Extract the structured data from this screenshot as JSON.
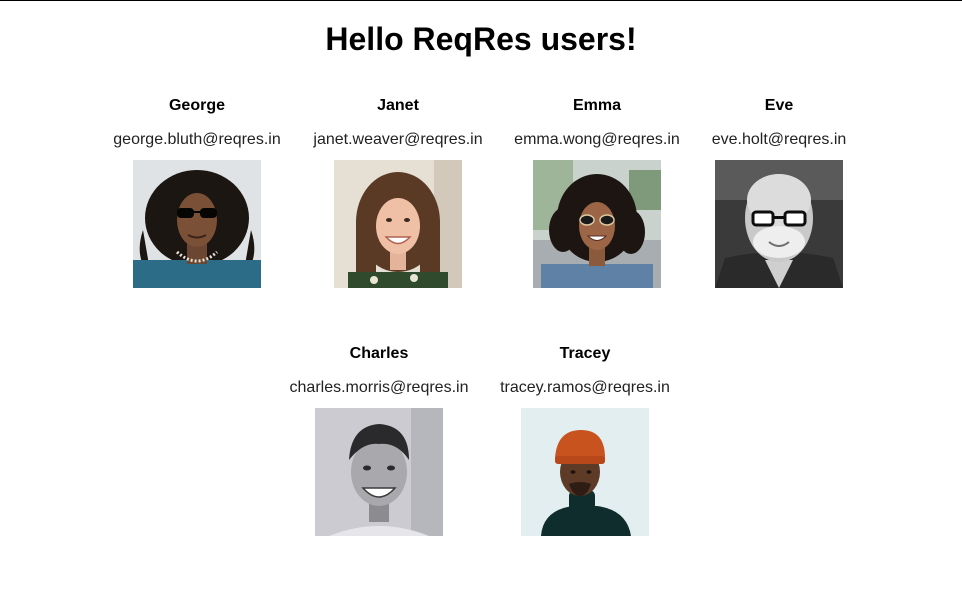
{
  "header": {
    "title": "Hello ReqRes users!"
  },
  "users": [
    {
      "first_name": "George",
      "email": "george.bluth@reqres.in"
    },
    {
      "first_name": "Janet",
      "email": "janet.weaver@reqres.in"
    },
    {
      "first_name": "Emma",
      "email": "emma.wong@reqres.in"
    },
    {
      "first_name": "Eve",
      "email": "eve.holt@reqres.in"
    },
    {
      "first_name": "Charles",
      "email": "charles.morris@reqres.in"
    },
    {
      "first_name": "Tracey",
      "email": "tracey.ramos@reqres.in"
    }
  ]
}
